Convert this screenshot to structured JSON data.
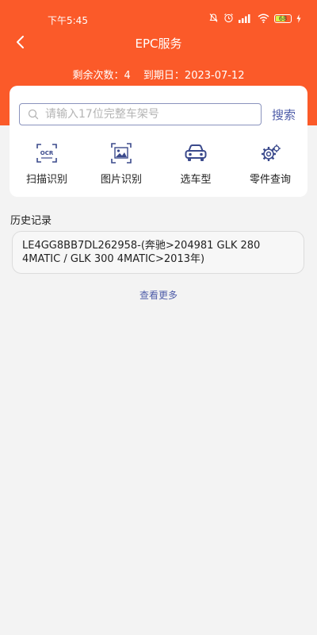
{
  "status_bar": {
    "time": "下午5:45",
    "battery": "68",
    "battery_level": 0.68
  },
  "nav": {
    "title": "EPC服务"
  },
  "info": {
    "remaining": "剩余次数：4",
    "expiry": "到期日：2023-07-12"
  },
  "search": {
    "placeholder": "请输入17位完整车架号",
    "button_label": "搜索"
  },
  "tools": [
    {
      "label": "扫描识别",
      "icon": "ocr-scan-icon"
    },
    {
      "label": "图片识别",
      "icon": "image-recognize-icon"
    },
    {
      "label": "选车型",
      "icon": "car-icon"
    },
    {
      "label": "零件查询",
      "icon": "parts-gear-icon"
    }
  ],
  "history": {
    "title": "历史记录",
    "items": [
      {
        "text": "LE4GG8BB7DL262958-(奔驰>204981 GLK 280 4MATIC / GLK 300 4MATIC>2013年)"
      }
    ],
    "more_label": "查看更多"
  },
  "colors": {
    "accent": "#fb5a29",
    "link": "#4e5ca8",
    "icon": "#3b4a8c"
  }
}
